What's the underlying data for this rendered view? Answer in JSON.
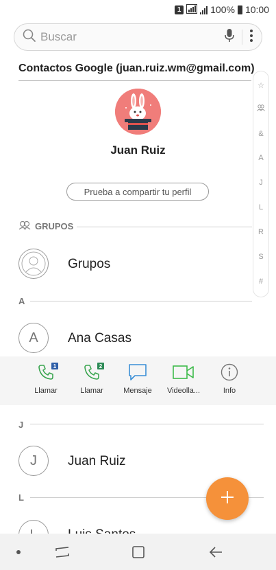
{
  "status_bar": {
    "sim_slot": "1",
    "battery_percent": "100%",
    "time": "10:00"
  },
  "search": {
    "placeholder": "Buscar"
  },
  "account": {
    "header": "Contactos Google (juan.ruiz.wm@gmail.com)"
  },
  "profile": {
    "name": "Juan Ruiz",
    "share_button": "Prueba a compartir tu perfil"
  },
  "index_letters": [
    "☆",
    "👥",
    "&",
    "A",
    "J",
    "L",
    "R",
    "S",
    "#"
  ],
  "groups_section": {
    "header": "GRUPOS",
    "item_label": "Grupos"
  },
  "sections": [
    {
      "letter": "A",
      "contacts": [
        {
          "initial": "A",
          "name": "Ana Casas"
        }
      ]
    },
    {
      "letter": "J",
      "contacts": [
        {
          "initial": "J",
          "name": "Juan Ruiz"
        }
      ]
    },
    {
      "letter": "L",
      "contacts": [
        {
          "initial": "L",
          "name": "Luis Santos"
        }
      ]
    }
  ],
  "actions": [
    {
      "label": "Llamar",
      "icon": "phone-sim1-icon",
      "badge": "1"
    },
    {
      "label": "Llamar",
      "icon": "phone-sim2-icon",
      "badge": "2"
    },
    {
      "label": "Mensaje",
      "icon": "message-icon"
    },
    {
      "label": "Videolla...",
      "icon": "video-call-icon"
    },
    {
      "label": "Info",
      "icon": "info-icon"
    }
  ],
  "colors": {
    "call_green": "#3aa54f",
    "sim1_badge": "#2f5fa8",
    "sim2_badge": "#2e8b57",
    "message_blue": "#3b8fd6",
    "video_green": "#3dba4a",
    "fab_orange": "#f5913a",
    "avatar_pink": "#f07d7a"
  }
}
